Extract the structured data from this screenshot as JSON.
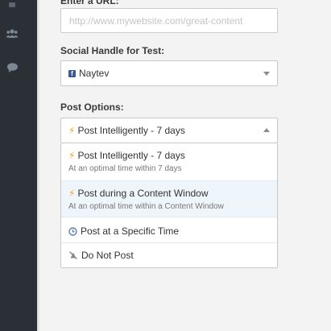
{
  "url_field": {
    "label": "Enter a URL:",
    "placeholder": "http://www.mywebsite.com/great-content",
    "value": ""
  },
  "social": {
    "label": "Social Handle for Test:",
    "selected": "Naytev",
    "network_icon": "facebook-icon"
  },
  "post_options": {
    "label": "Post Options:",
    "selected": "Post Intelligently - 7 days",
    "options": [
      {
        "title": "Post Intelligently - 7 days",
        "subtitle": "At an optimal time within 7 days",
        "icon": "lightning-icon"
      },
      {
        "title": "Post during a Content Window",
        "subtitle": "At an optimal time within a Content Window",
        "icon": "lightning-icon"
      },
      {
        "title": "Post at a Specific Time",
        "icon": "clock-icon"
      },
      {
        "title": "Do Not Post",
        "icon": "do-not-post-icon"
      }
    ]
  },
  "colors": {
    "sidebar": "#2b3036",
    "accent_bolt": "#f5a623",
    "facebook": "#3b5998",
    "clock": "#5a7fae",
    "highlight": "#eef5fb"
  }
}
